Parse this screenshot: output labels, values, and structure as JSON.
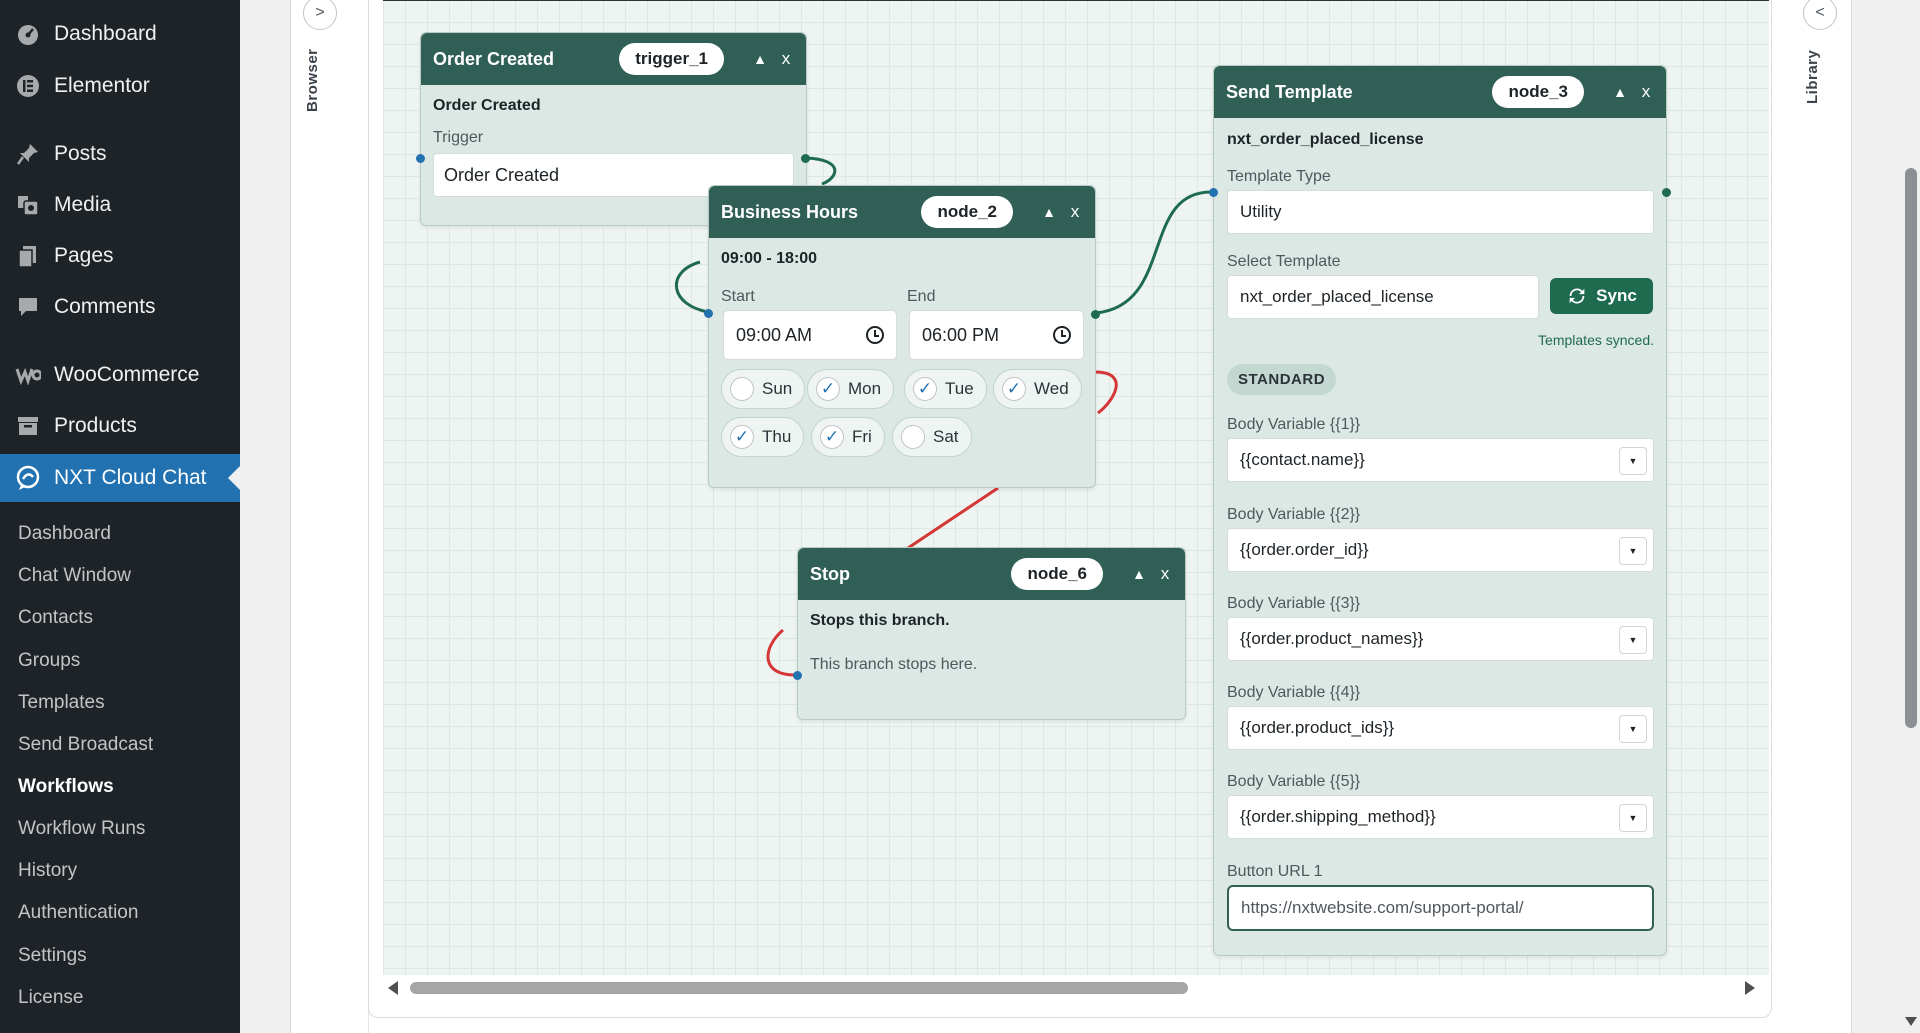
{
  "sidebar": {
    "top_items": [
      {
        "label": "Dashboard",
        "icon": "dashboard-icon"
      },
      {
        "label": "Elementor",
        "icon": "elementor-icon"
      },
      {
        "label": "Posts",
        "icon": "pin-icon"
      },
      {
        "label": "Media",
        "icon": "media-icon"
      },
      {
        "label": "Pages",
        "icon": "pages-icon"
      },
      {
        "label": "Comments",
        "icon": "comment-icon"
      },
      {
        "label": "WooCommerce",
        "icon": "woocommerce-icon"
      },
      {
        "label": "Products",
        "icon": "archive-icon"
      },
      {
        "label": "NXT Cloud Chat",
        "icon": "chat-icon"
      }
    ],
    "sub_items": [
      "Dashboard",
      "Chat Window",
      "Contacts",
      "Groups",
      "Templates",
      "Send Broadcast",
      "Workflows",
      "Workflow Runs",
      "History",
      "Authentication",
      "Settings",
      "License"
    ]
  },
  "rails": {
    "left_label": "Browser",
    "left_toggle": ">",
    "right_label": "Library",
    "right_toggle": "<"
  },
  "nodes": {
    "trigger": {
      "title": "Order Created",
      "id": "trigger_1",
      "subtitle": "Order Created",
      "field_label": "Trigger",
      "field_value": "Order Created"
    },
    "business_hours": {
      "title": "Business Hours",
      "id": "node_2",
      "subtitle": "09:00 - 18:00",
      "start_label": "Start",
      "end_label": "End",
      "start_value": "09:00  AM",
      "end_value": "06:00  PM",
      "days": [
        {
          "label": "Sun",
          "checked": false
        },
        {
          "label": "Mon",
          "checked": true
        },
        {
          "label": "Tue",
          "checked": true
        },
        {
          "label": "Wed",
          "checked": true
        },
        {
          "label": "Thu",
          "checked": true
        },
        {
          "label": "Fri",
          "checked": true
        },
        {
          "label": "Sat",
          "checked": false
        }
      ]
    },
    "stop": {
      "title": "Stop",
      "id": "node_6",
      "subtitle": "Stops this branch.",
      "note": "This branch stops here."
    },
    "send_template": {
      "title": "Send Template",
      "id": "node_3",
      "subtitle": "nxt_order_placed_license",
      "template_type_label": "Template Type",
      "template_type_value": "Utility",
      "select_template_label": "Select Template",
      "select_template_value": "nxt_order_placed_license",
      "sync_label": "Sync",
      "sync_status": "Templates synced.",
      "section_badge": "STANDARD",
      "variables": [
        {
          "label": "Body Variable {{1}}",
          "value": "{{contact.name}}"
        },
        {
          "label": "Body Variable {{2}}",
          "value": "{{order.order_id}}"
        },
        {
          "label": "Body Variable {{3}}",
          "value": "{{order.product_names}}"
        },
        {
          "label": "Body Variable {{4}}",
          "value": "{{order.product_ids}}"
        },
        {
          "label": "Body Variable {{5}}",
          "value": "{{order.shipping_method}}"
        }
      ],
      "button_url_label": "Button URL 1",
      "button_url_value": "https://nxtwebsite.com/support-portal/"
    }
  },
  "controls": {
    "collapse_glyph": "▲",
    "close_glyph": "x",
    "check_glyph": "✓",
    "caret_glyph": "▼"
  },
  "colors": {
    "sidebar_bg": "#1d2327",
    "active_menu": "#2271b1",
    "node_header": "#2f5f55",
    "node_body": "#dbe8e4",
    "edge_green": "#1f6b4f",
    "edge_red": "#d63638"
  }
}
